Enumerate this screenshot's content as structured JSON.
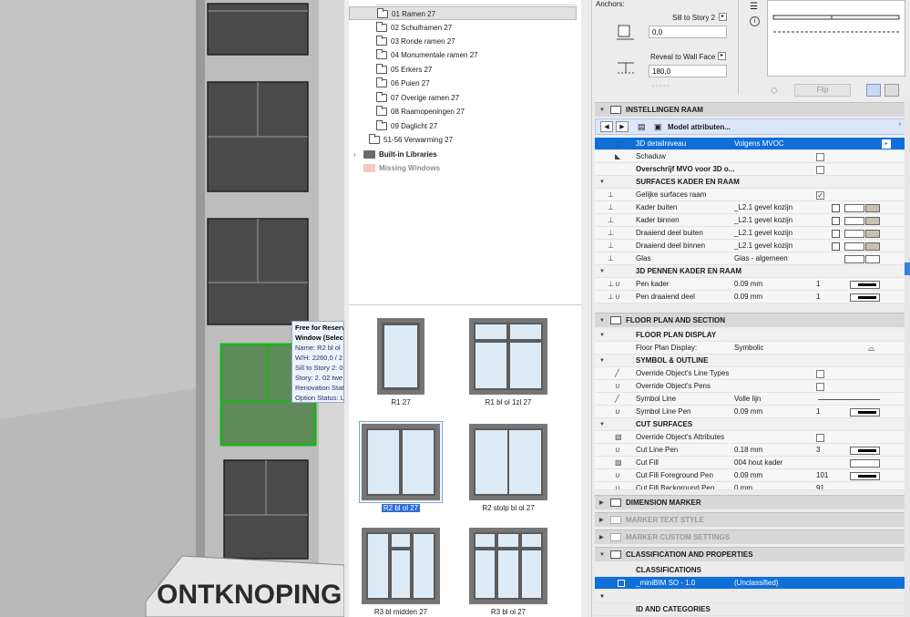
{
  "viewport": {
    "building_sign": "ONTKNOPING",
    "tooltip": {
      "lines": [
        "Free for Reserv",
        "Window (Selec",
        "Name: R2 bl ol ",
        "W/H: 2260,0 / 2",
        "Sill to Story 2: 0",
        "Story: 2. 02 twe",
        "Renovation Stat",
        "Option Status: L"
      ]
    }
  },
  "library": {
    "tree": [
      {
        "label": "01 Ramen 27",
        "selected": true
      },
      {
        "label": "02 Schuiframen 27"
      },
      {
        "label": "03 Ronde ramen 27"
      },
      {
        "label": "04 Monumentale ramen 27"
      },
      {
        "label": "05 Erkers 27"
      },
      {
        "label": "06 Puien 27"
      },
      {
        "label": "07 Overige ramen 27"
      },
      {
        "label": "08 Raamopeningen 27"
      },
      {
        "label": "09 Daglicht 27"
      },
      {
        "label": "51-56 Verwarming 27"
      },
      {
        "label": "Built-in Libraries"
      },
      {
        "label": "Missing Windows"
      }
    ],
    "previews": [
      {
        "label": "R1 27"
      },
      {
        "label": "R1 bl ol 1zl 27"
      },
      {
        "label": "R2 bl ol 27",
        "selected": true
      },
      {
        "label": "R2 stolp bl ol 27"
      },
      {
        "label": "R3 bl midden 27"
      },
      {
        "label": "R3 bl ol 27"
      }
    ]
  },
  "anchors": {
    "title": "Anchors:",
    "sill_label": "Sill to Story 2",
    "sill_value": "0,0",
    "reveal_label": "Reveal to Wall Face",
    "reveal_value": "180,0",
    "flip_label": "Flip"
  },
  "settings": {
    "header": "INSTELLINGEN RAAM",
    "model_attributes": "Model attributen...",
    "rows": [
      {
        "name": "3D detailniveau",
        "value": "Volgens MVOC"
      },
      {
        "name": "Schaduw"
      },
      {
        "name": "Overschrijf MVO voor 3D o..."
      },
      {
        "name": "SURFACES KADER EN RAAM"
      },
      {
        "name": "Gelijke surfaces raam",
        "check": "✓"
      },
      {
        "name": "Kader buiten",
        "value": "_L2.1 gevel kozijn"
      },
      {
        "name": "Kader binnen",
        "value": "_L2.1 gevel kozijn"
      },
      {
        "name": "Draaiend deel buiten",
        "value": "_L2.1 gevel kozijn"
      },
      {
        "name": "Draaiend deel binnen",
        "value": "_L2.1 gevel kozijn"
      },
      {
        "name": "Glas",
        "value": "Glas - algemeen"
      },
      {
        "name": "3D PENNEN KADER EN RAAM"
      },
      {
        "name": "Pen kader",
        "value": "0.09 mm",
        "num": "1"
      },
      {
        "name": "Pen draaiend deel",
        "value": "0.09 mm",
        "num": "1"
      }
    ],
    "floor_plan_section": "FLOOR PLAN AND SECTION",
    "floor_rows": [
      {
        "name": "FLOOR PLAN DISPLAY"
      },
      {
        "name": "Floor Plan Display:",
        "value": "Symbolic"
      },
      {
        "name": "SYMBOL & OUTLINE"
      },
      {
        "name": "Override Object's Line Types"
      },
      {
        "name": "Override Object's Pens"
      },
      {
        "name": "Symbol Line",
        "value": "Volle lijn"
      },
      {
        "name": "Symbol Line Pen",
        "value": "0.09 mm",
        "num": "1"
      },
      {
        "name": "CUT SURFACES"
      },
      {
        "name": "Override Object's Attributes"
      },
      {
        "name": "Cut Line Pen",
        "value": "0.18 mm",
        "num": "3"
      },
      {
        "name": "Cut Fill",
        "value": "004 hout kader"
      },
      {
        "name": "Cut Fill Foreground Pen",
        "value": "0.09 mm",
        "num": "101"
      },
      {
        "name": "Cut Fill Background Pen",
        "value": "0 mm",
        "num": "91"
      }
    ],
    "dimension_marker": "DIMENSION MARKER",
    "marker_text_style": "MARKER TEXT STYLE",
    "marker_custom_settings": "MARKER CUSTOM SETTINGS",
    "classification_section": "CLASSIFICATION AND PROPERTIES",
    "classifications_label": "CLASSIFICATIONS",
    "classification_row": {
      "name": "_miniBIM SO - 1.0",
      "value": "(Unclassified)"
    },
    "id_and_categories": "ID AND CATEGORIES"
  }
}
